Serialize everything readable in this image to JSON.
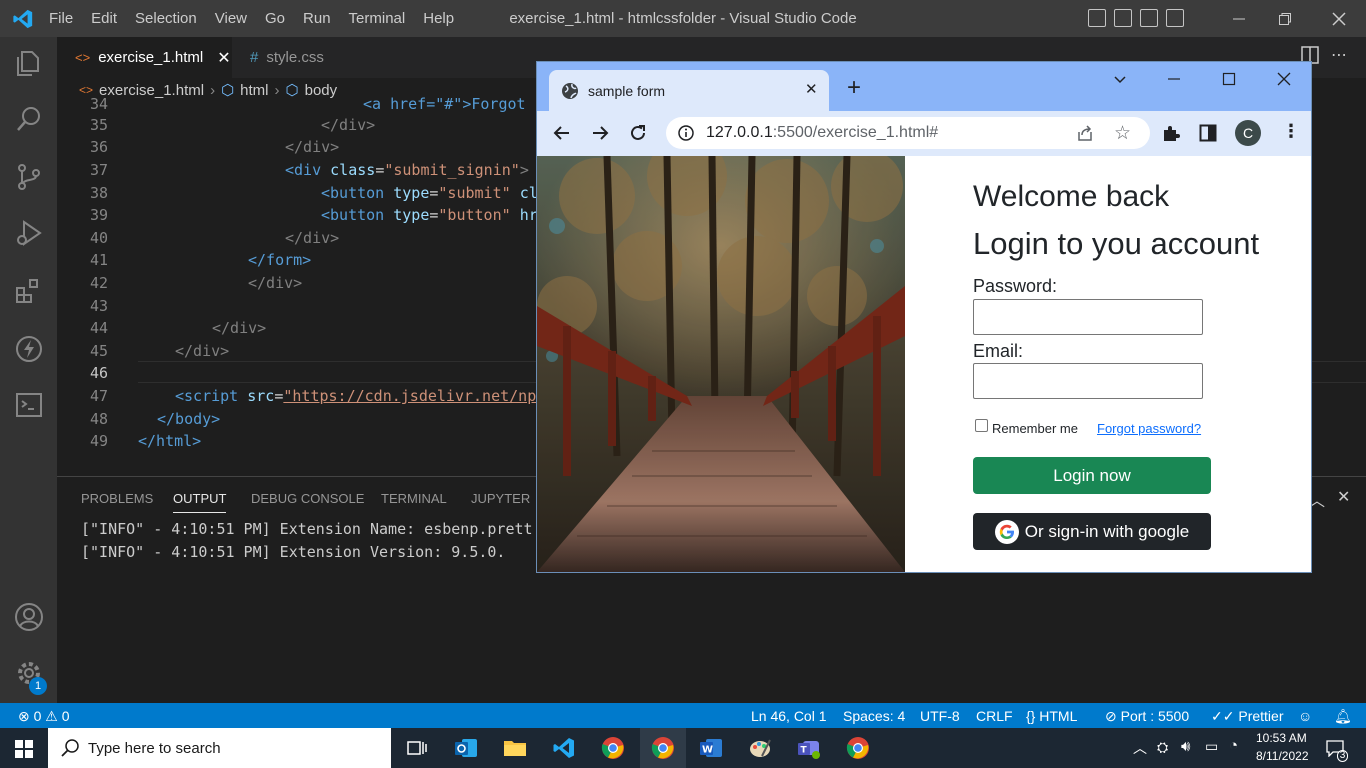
{
  "vscode": {
    "menu": [
      "File",
      "Edit",
      "Selection",
      "View",
      "Go",
      "Run",
      "Terminal",
      "Help"
    ],
    "window_title": "exercise_1.html - htmlcssfolder - Visual Studio Code",
    "tabs": [
      {
        "label": "exercise_1.html",
        "active": true
      },
      {
        "label": "style.css",
        "active": false
      }
    ],
    "breadcrumb": [
      "exercise_1.html",
      "html",
      "body"
    ],
    "line_numbers": [
      "34",
      "35",
      "36",
      "37",
      "38",
      "39",
      "40",
      "41",
      "42",
      "43",
      "44",
      "45",
      "46",
      "47",
      "48",
      "49"
    ],
    "code": {
      "l34": "<a href=\"#\">Forgot p",
      "l35": "</div>",
      "l36": "</div>",
      "l37_tag": "<div",
      "l37_attr": "class",
      "l37_val": "\"submit_signin\"",
      "l38_tag": "<button",
      "l38_attr": "type",
      "l38_val": "\"submit\"",
      "l38_rest": "cl",
      "l39_tag": "<button",
      "l39_attr": "type",
      "l39_val": "\"button\"",
      "l39_rest": "hr",
      "l40": "</div>",
      "l41": "</form>",
      "l42": "</div>",
      "l44": "</div>",
      "l45": "</div>",
      "l47_tag": "<script",
      "l47_attr": "src",
      "l47_val": "\"https://cdn.jsdelivr.net/np",
      "l48": "</body>",
      "l49": "</html>"
    },
    "panel_tabs": [
      "PROBLEMS",
      "OUTPUT",
      "DEBUG CONSOLE",
      "TERMINAL",
      "JUPYTER"
    ],
    "output_lines": [
      "[\"INFO\" - 4:10:51 PM] Extension Name: esbenp.prett",
      "[\"INFO\" - 4:10:51 PM] Extension Version: 9.5.0."
    ],
    "status": {
      "errors": "0",
      "warnings": "0",
      "position": "Ln 46, Col 1",
      "spaces": "Spaces: 4",
      "encoding": "UTF-8",
      "eol": "CRLF",
      "language": "HTML",
      "port": "Port : 5500",
      "formatter": "Prettier"
    },
    "settings_badge": "1"
  },
  "browser": {
    "tab_title": "sample form",
    "url_host": "127.0.0.1",
    "url_rest": ":5500/exercise_1.html#",
    "profile_initial": "C",
    "page": {
      "welcome": "Welcome back",
      "heading": "Login to you account",
      "password_label": "Password:",
      "email_label": "Email:",
      "remember": "Remember me",
      "forgot": "Forgot password?",
      "login_button": "Login now",
      "google_button": "Or sign-in with google",
      "login_color": "#198754",
      "google_color": "#212529",
      "forgot_color": "#0d6efd"
    }
  },
  "taskbar": {
    "search_placeholder": "Type here to search",
    "time": "10:53 AM",
    "date": "8/11/2022",
    "notification_count": "3"
  },
  "colors": {
    "vscode_accent": "#007acc",
    "titlebar": "#3c3c3c",
    "chrome_frame": "#8ab4f8"
  }
}
